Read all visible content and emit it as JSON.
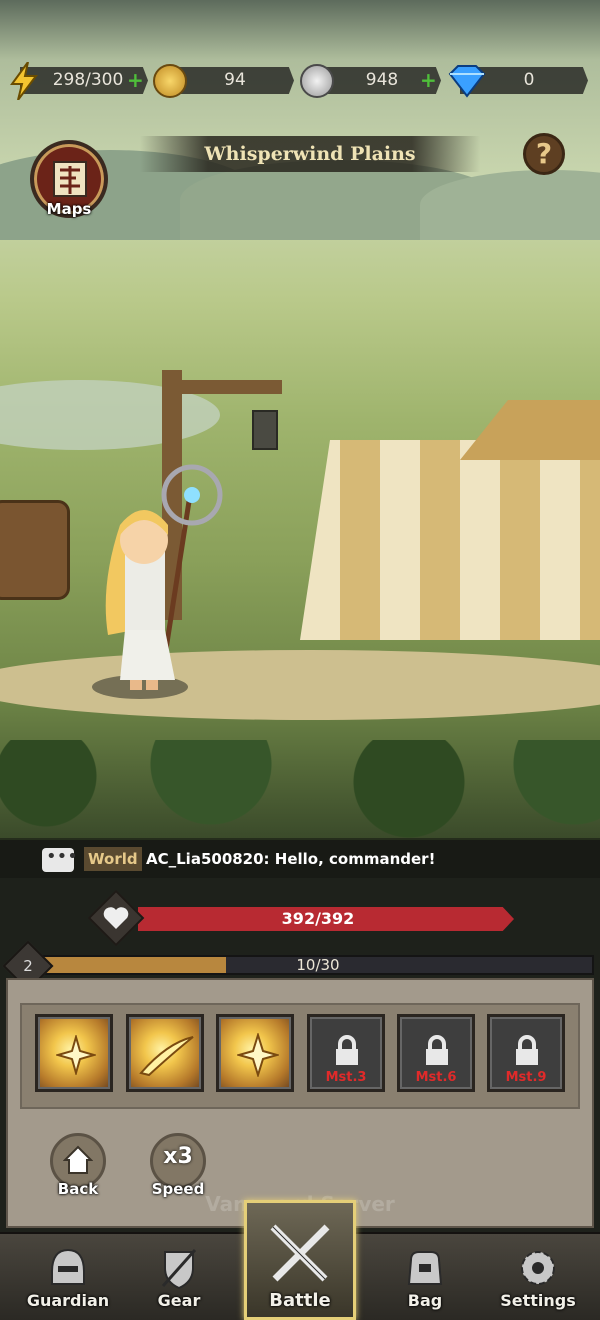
{
  "resources": {
    "energy": "298/300",
    "gold": "94",
    "silver": "948",
    "gems": "0"
  },
  "location": {
    "title": "Whisperwind Plains"
  },
  "maps_label": "Maps",
  "chat": {
    "channel": "World",
    "message": "AC_Lia500820: Hello, commander!"
  },
  "hp": {
    "text": "392/392",
    "fraction": 1.0
  },
  "level": {
    "value": "2",
    "xp_text": "10/30",
    "xp_fraction": 0.333
  },
  "skills": [
    {
      "type": "unlocked"
    },
    {
      "type": "unlocked"
    },
    {
      "type": "unlocked"
    },
    {
      "type": "locked",
      "label": "Mst.3"
    },
    {
      "type": "locked",
      "label": "Mst.6"
    },
    {
      "type": "locked",
      "label": "Mst.9"
    }
  ],
  "controls": {
    "back": "Back",
    "speed_value": "x3",
    "speed": "Speed"
  },
  "server": "Vanguard Server",
  "nav": {
    "guardian": "Guardian",
    "gear": "Gear",
    "battle": "Battle",
    "bag": "Bag",
    "settings": "Settings"
  },
  "colors": {
    "hp": "#b82a32",
    "xp": "#b8873e",
    "plus": "#4fbf3a",
    "locked": "#e02a2a",
    "active_tab": "#e5cf78"
  }
}
